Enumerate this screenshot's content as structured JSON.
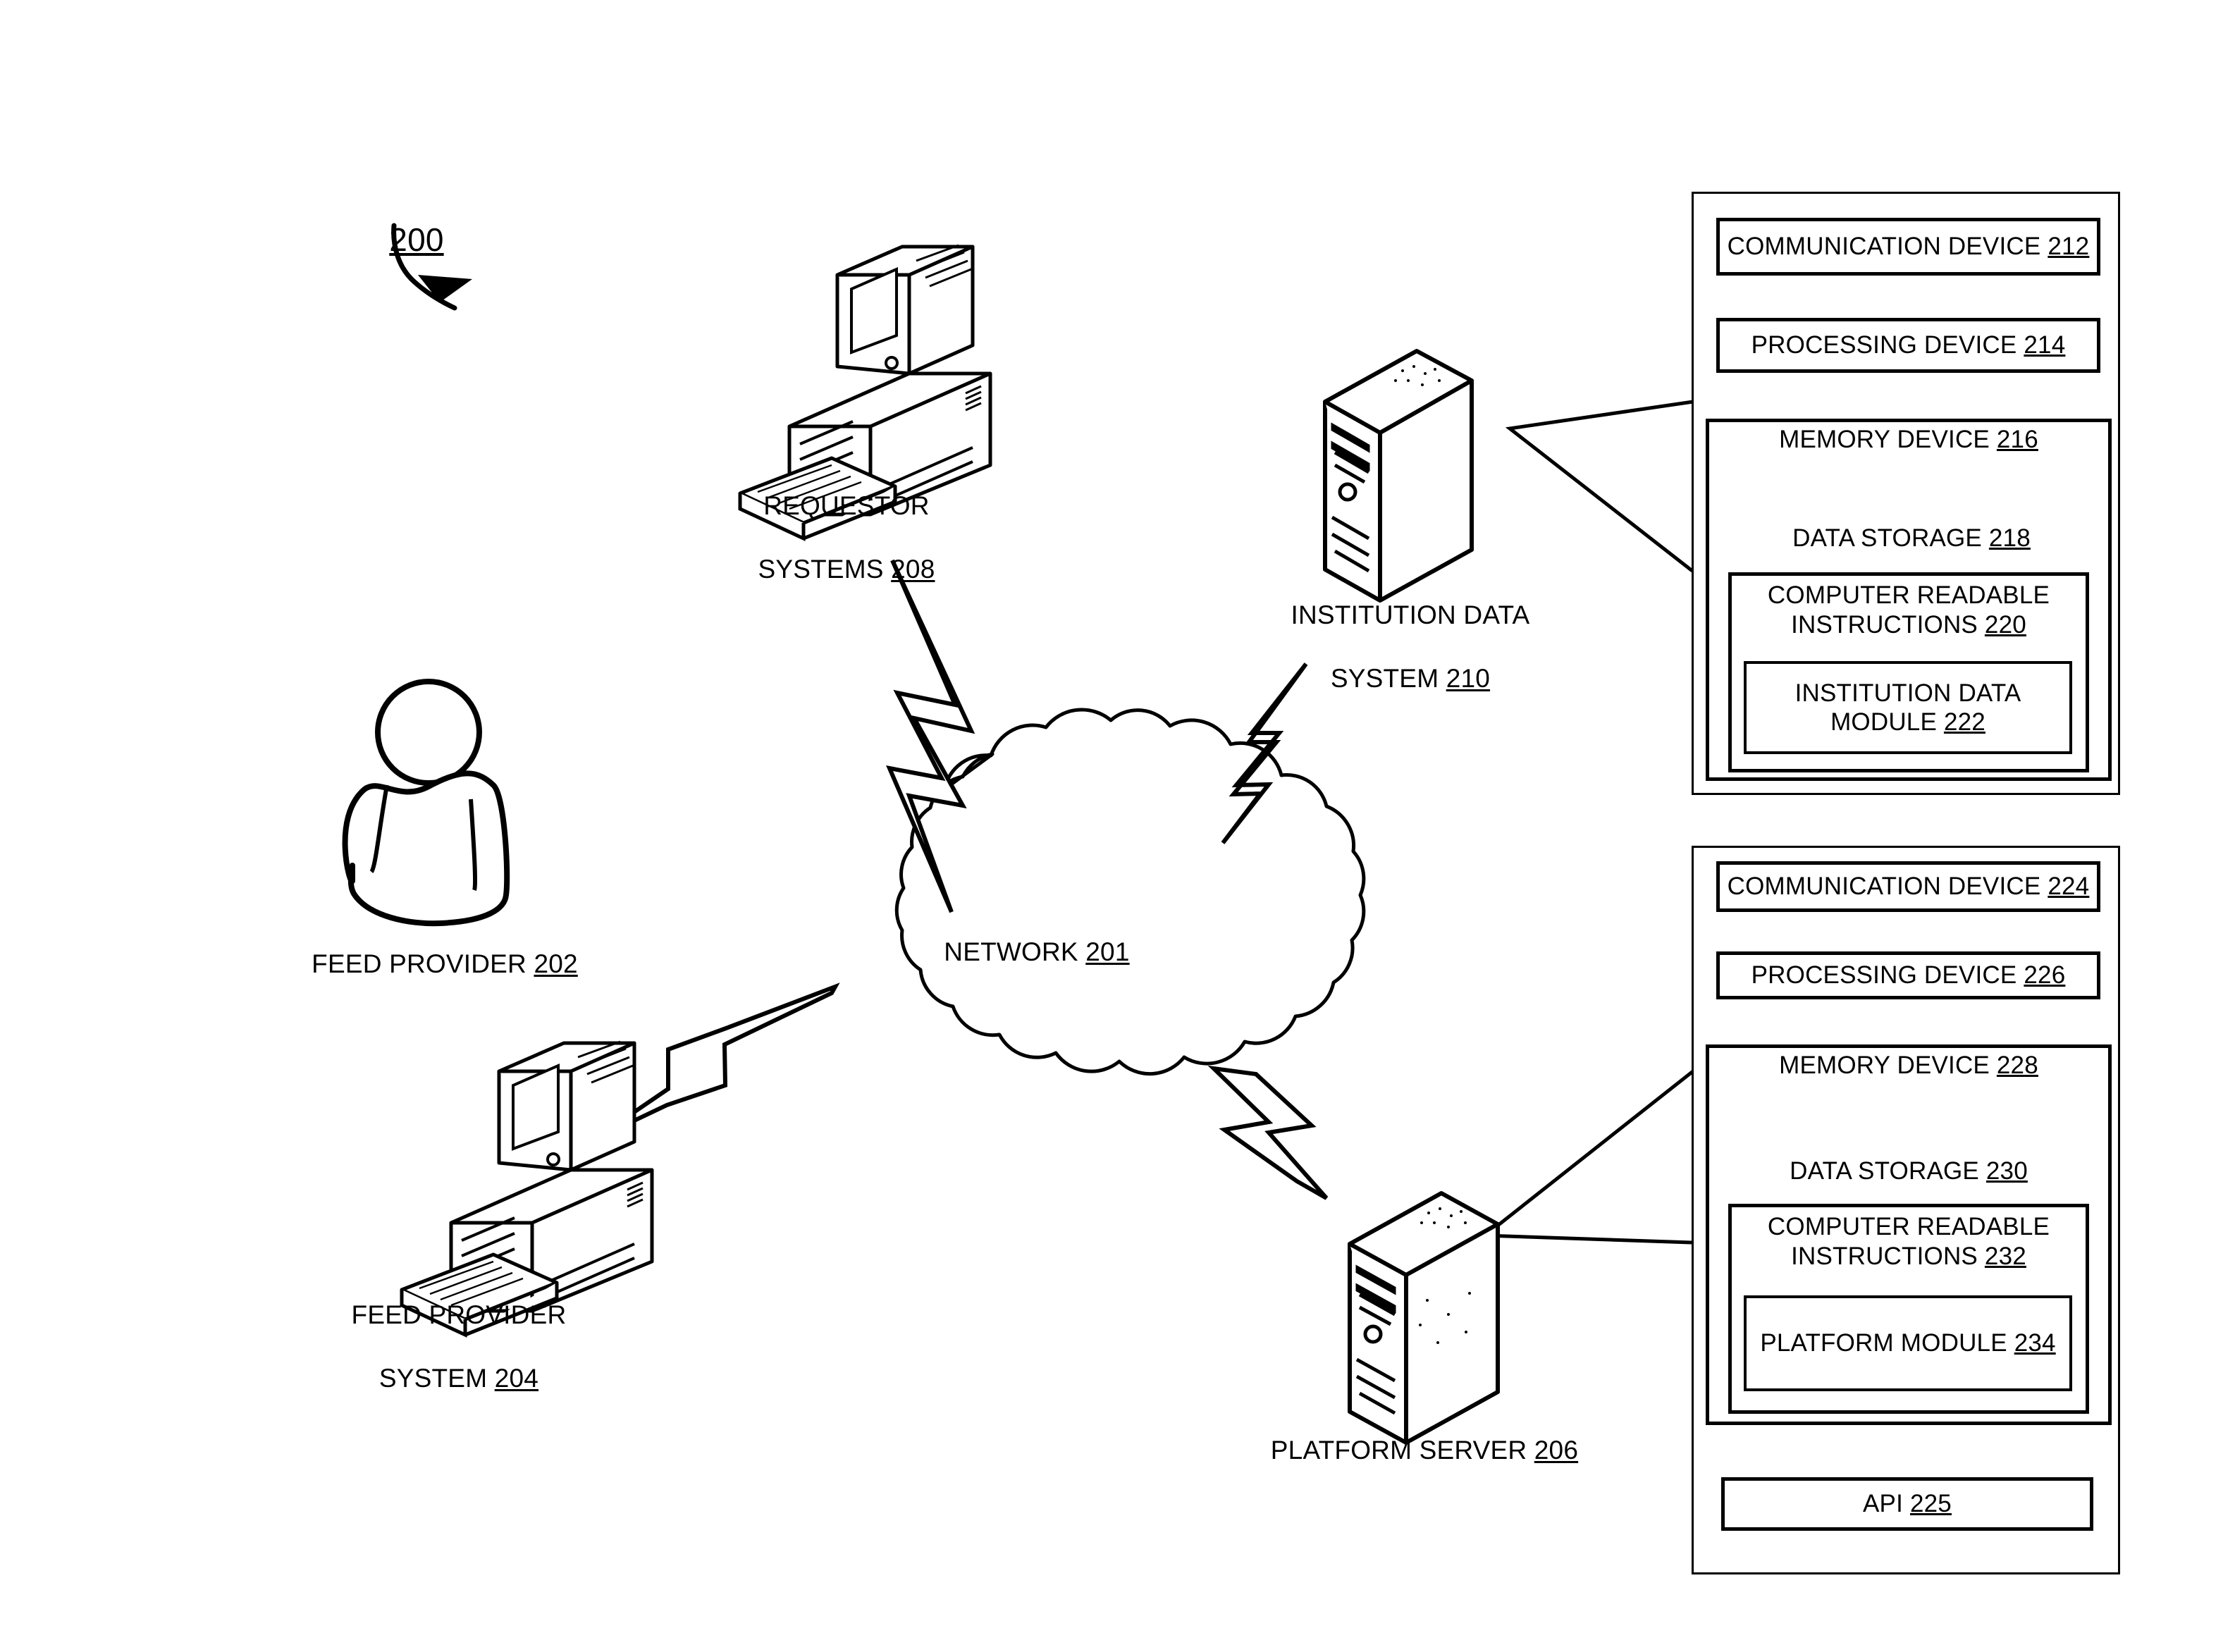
{
  "figure": {
    "reference_numeral": "200",
    "network": {
      "label": "NETWORK ",
      "ref": "201"
    },
    "nodes": [
      {
        "name": "feed-provider",
        "line1": "FEED PROVIDER ",
        "line2": "",
        "ref": "202"
      },
      {
        "name": "feed-provider-system",
        "line1": "FEED PROVIDER",
        "line2": "SYSTEM ",
        "ref": "204"
      },
      {
        "name": "requestor-systems",
        "line1": "REQUESTOR",
        "line2": "SYSTEMS ",
        "ref": "208"
      },
      {
        "name": "institution-data-system",
        "line1": "INSTITUTION DATA",
        "line2": "SYSTEM ",
        "ref": "210"
      },
      {
        "name": "platform-server",
        "line1": "PLATFORM SERVER ",
        "line2": "",
        "ref": "206"
      }
    ]
  },
  "institution_panel": {
    "communication_device": {
      "text": "COMMUNICATION DEVICE ",
      "ref": "212"
    },
    "processing_device": {
      "text": "PROCESSING DEVICE ",
      "ref": "214"
    },
    "memory_device": {
      "text": "MEMORY DEVICE ",
      "ref": "216"
    },
    "data_storage": {
      "text": "DATA STORAGE ",
      "ref": "218"
    },
    "computer_readable_instructions": {
      "line1": "COMPUTER READABLE",
      "line2": "INSTRUCTIONS ",
      "ref": "220"
    },
    "module": {
      "line1": "INSTITUTION DATA",
      "line2": "MODULE ",
      "ref": "222"
    }
  },
  "platform_panel": {
    "communication_device": {
      "text": "COMMUNICATION DEVICE ",
      "ref": "224"
    },
    "processing_device": {
      "text": "PROCESSING DEVICE ",
      "ref": "226"
    },
    "memory_device": {
      "text": "MEMORY DEVICE ",
      "ref": "228"
    },
    "data_storage": {
      "text": "DATA STORAGE ",
      "ref": "230"
    },
    "computer_readable_instructions": {
      "line1": "COMPUTER READABLE",
      "line2": "INSTRUCTIONS ",
      "ref": "232"
    },
    "module": {
      "text": "PLATFORM MODULE ",
      "ref": "234"
    },
    "api": {
      "text": "API ",
      "ref": "225"
    }
  },
  "colors": {
    "ink": "#000000",
    "paper": "#ffffff"
  }
}
